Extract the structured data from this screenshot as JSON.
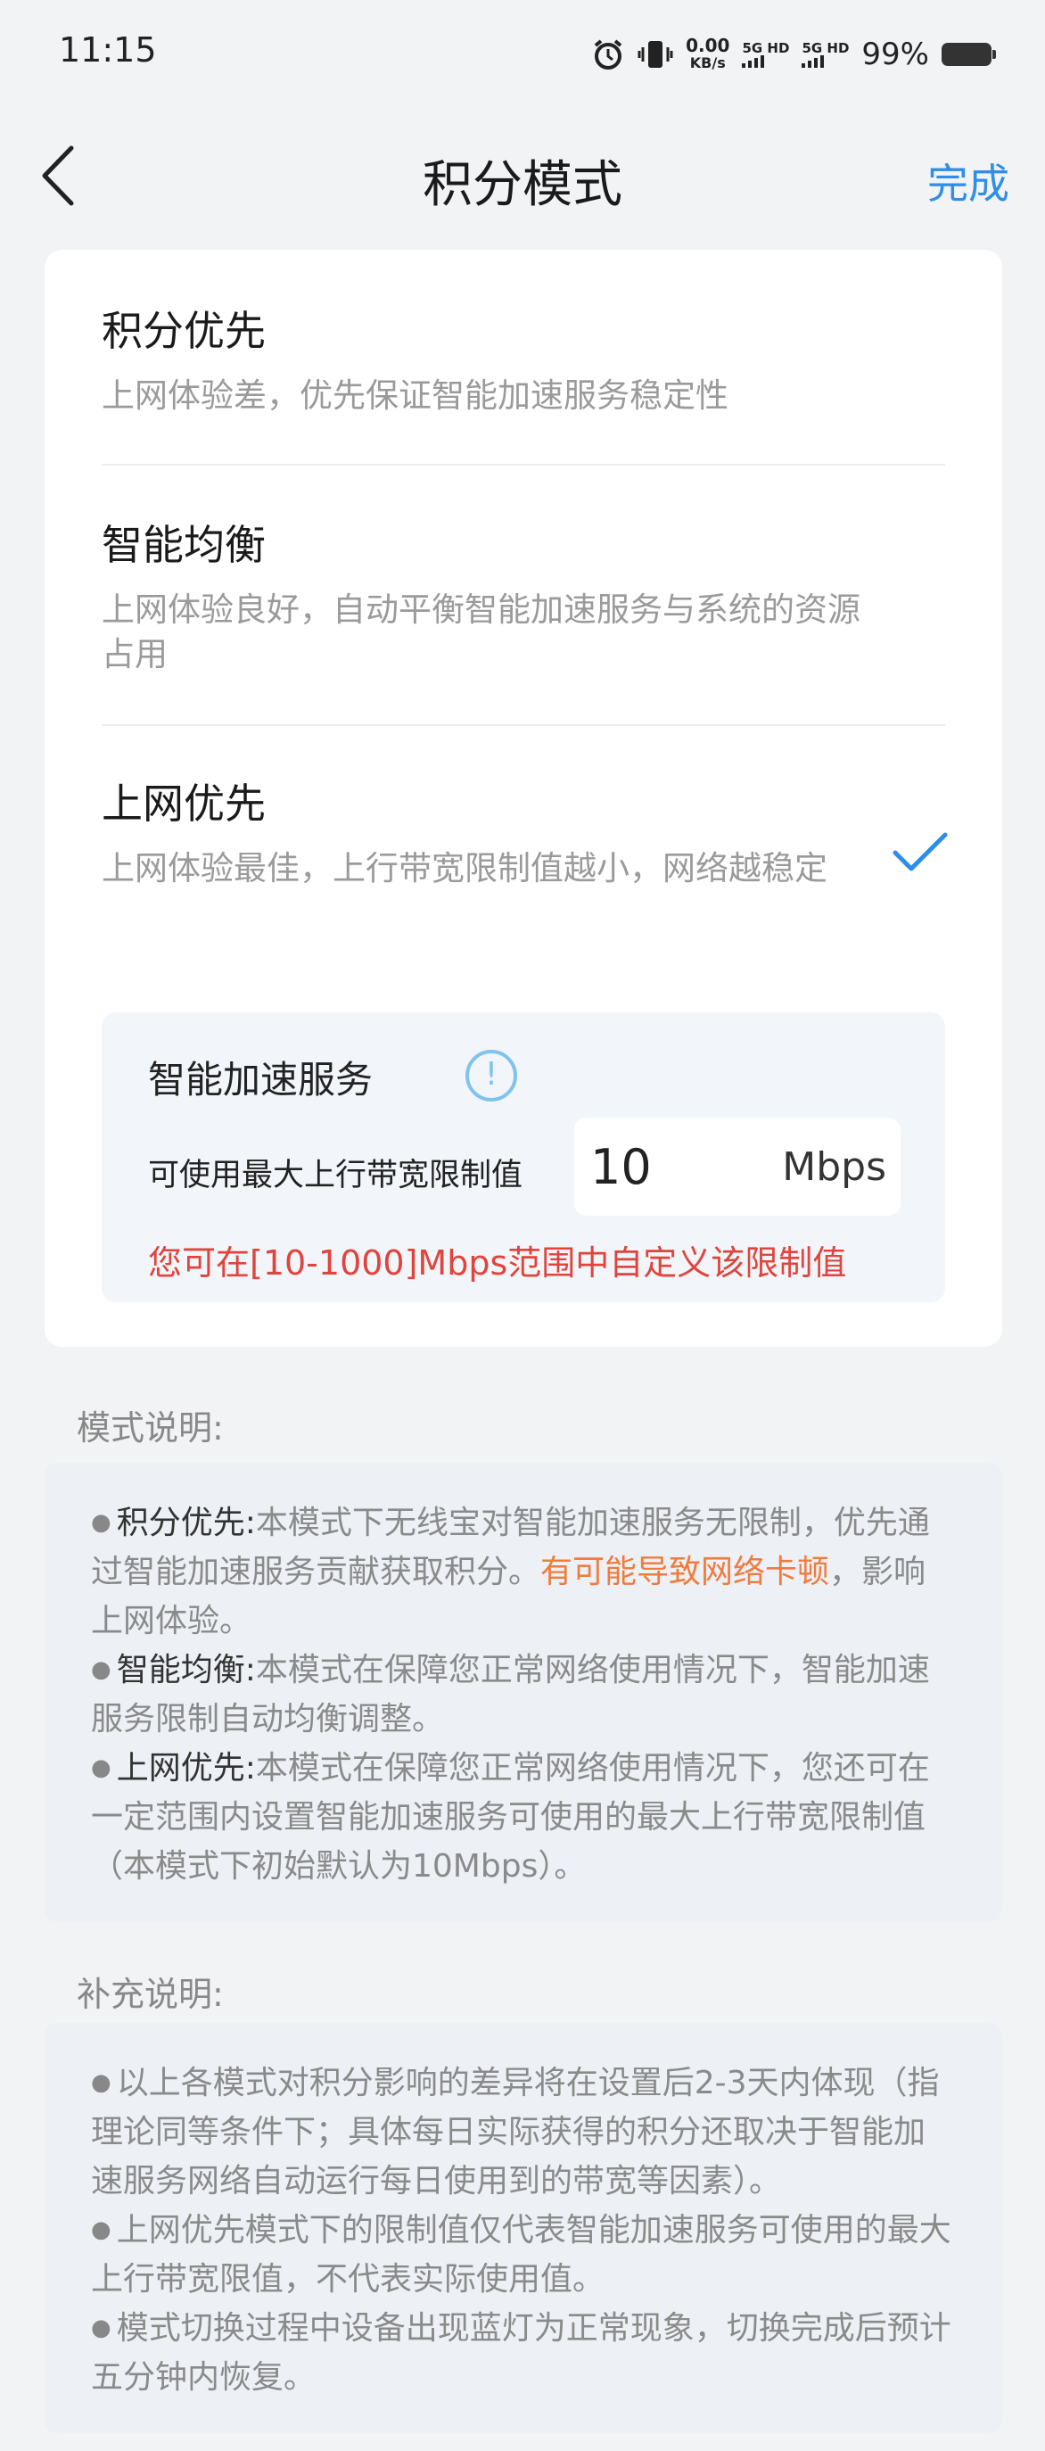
{
  "status_bar": {
    "time": "11:15",
    "net_speed_value": "0.00",
    "net_speed_unit": "KB/s",
    "sim1_label": "5G HD",
    "sim2_label": "5G HD",
    "battery_percent": "99%"
  },
  "nav": {
    "title": "积分模式",
    "done_label": "完成"
  },
  "options": [
    {
      "title": "积分优先",
      "desc": "上网体验差，优先保证智能加速服务稳定性",
      "selected": false
    },
    {
      "title": "智能均衡",
      "desc": "上网体验良好，自动平衡智能加速服务与系统的资源占用",
      "selected": false
    },
    {
      "title": "上网优先",
      "desc": "上网体验最佳，上行带宽限制值越小，网络越稳定",
      "selected": true
    }
  ],
  "service": {
    "title": "智能加速服务",
    "info_icon": "info-icon",
    "limit_label": "可使用最大上行带宽限制值",
    "limit_value": "10",
    "limit_unit": "Mbps",
    "hint": "您可在[10-1000]Mbps范围中自定义该限制值"
  },
  "mode_notes": {
    "label": "模式说明:",
    "items": [
      {
        "key": "积分优先:",
        "text": "本模式下无线宝对智能加速服务无限制，优先通过智能加速服务贡献获取积分。",
        "warn": "有可能导致网络卡顿",
        "tail": "，影响上网体验。"
      },
      {
        "key": "智能均衡:",
        "text": "本模式在保障您正常网络使用情况下，智能加速服务限制自动均衡调整。"
      },
      {
        "key": "上网优先:",
        "text": "本模式在保障您正常网络使用情况下，您还可在一定范围内设置智能加速服务可使用的最大上行带宽限制值（本模式下初始默认为10Mbps）。"
      }
    ]
  },
  "extra_notes": {
    "label": "补充说明:",
    "items": [
      "以上各模式对积分影响的差异将在设置后2-3天内体现（指理论同等条件下；具体每日实际获得的积分还取决于智能加速服务网络自动运行每日使用到的带宽等因素）。",
      "上网优先模式下的限制值仅代表智能加速服务可使用的最大上行带宽限值，不代表实际使用值。",
      "模式切换过程中设备出现蓝灯为正常现象，切换完成后预计五分钟内恢复。"
    ]
  },
  "colors": {
    "accent": "#2f8ee8",
    "warning_red": "#e0443c",
    "warning_orange": "#f07b3f"
  }
}
